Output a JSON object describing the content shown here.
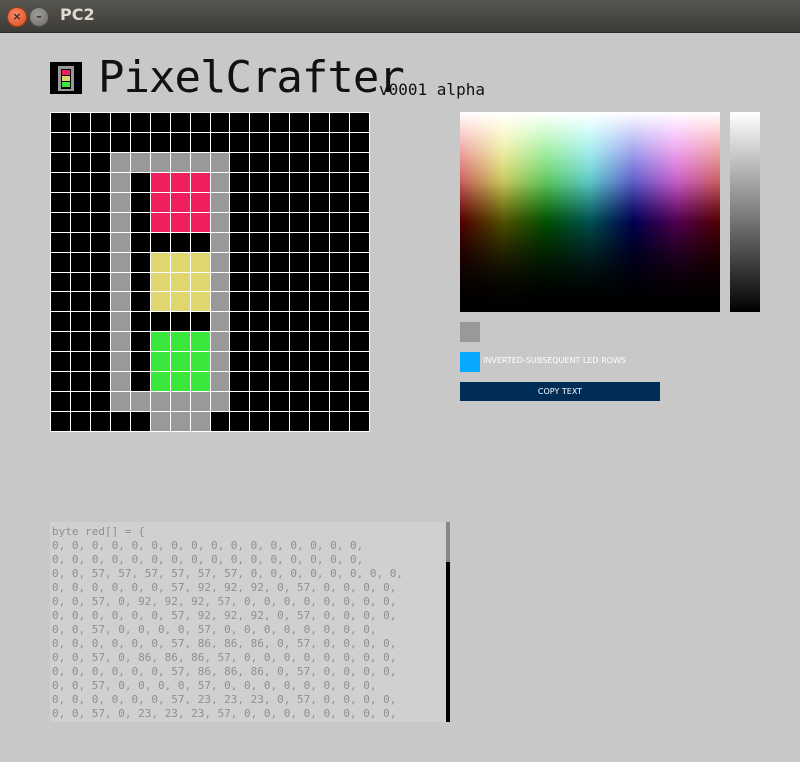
{
  "window": {
    "title": "PC2",
    "close_glyph": "×",
    "minimize_glyph": "–"
  },
  "app": {
    "title": "PixelCrafter",
    "version": "v0001 alpha"
  },
  "colors": {
    "accent": "#06a9ff",
    "button_bg": "#002d55",
    "grid_border": "#ffffff"
  },
  "grid": {
    "size": 16,
    "palette": {
      "0": "#000000",
      "1": "#999999",
      "2": "#ee1f5c",
      "3": "#dfd66f",
      "4": "#39e83b"
    },
    "pixels": [
      [
        0,
        0,
        0,
        0,
        0,
        0,
        0,
        0,
        0,
        0,
        0,
        0,
        0,
        0,
        0,
        0
      ],
      [
        0,
        0,
        0,
        0,
        0,
        0,
        0,
        0,
        0,
        0,
        0,
        0,
        0,
        0,
        0,
        0
      ],
      [
        0,
        0,
        0,
        1,
        1,
        1,
        1,
        1,
        1,
        0,
        0,
        0,
        0,
        0,
        0,
        0
      ],
      [
        0,
        0,
        0,
        1,
        0,
        2,
        2,
        2,
        1,
        0,
        0,
        0,
        0,
        0,
        0,
        0
      ],
      [
        0,
        0,
        0,
        1,
        0,
        2,
        2,
        2,
        1,
        0,
        0,
        0,
        0,
        0,
        0,
        0
      ],
      [
        0,
        0,
        0,
        1,
        0,
        2,
        2,
        2,
        1,
        0,
        0,
        0,
        0,
        0,
        0,
        0
      ],
      [
        0,
        0,
        0,
        1,
        0,
        0,
        0,
        0,
        1,
        0,
        0,
        0,
        0,
        0,
        0,
        0
      ],
      [
        0,
        0,
        0,
        1,
        0,
        3,
        3,
        3,
        1,
        0,
        0,
        0,
        0,
        0,
        0,
        0
      ],
      [
        0,
        0,
        0,
        1,
        0,
        3,
        3,
        3,
        1,
        0,
        0,
        0,
        0,
        0,
        0,
        0
      ],
      [
        0,
        0,
        0,
        1,
        0,
        3,
        3,
        3,
        1,
        0,
        0,
        0,
        0,
        0,
        0,
        0
      ],
      [
        0,
        0,
        0,
        1,
        0,
        0,
        0,
        0,
        1,
        0,
        0,
        0,
        0,
        0,
        0,
        0
      ],
      [
        0,
        0,
        0,
        1,
        0,
        4,
        4,
        4,
        1,
        0,
        0,
        0,
        0,
        0,
        0,
        0
      ],
      [
        0,
        0,
        0,
        1,
        0,
        4,
        4,
        4,
        1,
        0,
        0,
        0,
        0,
        0,
        0,
        0
      ],
      [
        0,
        0,
        0,
        1,
        0,
        4,
        4,
        4,
        1,
        0,
        0,
        0,
        0,
        0,
        0,
        0
      ],
      [
        0,
        0,
        0,
        1,
        1,
        1,
        1,
        1,
        1,
        0,
        0,
        0,
        0,
        0,
        0,
        0
      ],
      [
        0,
        0,
        0,
        0,
        0,
        1,
        1,
        1,
        0,
        0,
        0,
        0,
        0,
        0,
        0,
        0
      ]
    ]
  },
  "controls": {
    "current_color": "#999999",
    "toggle_label": "INVERTED-SUBSEQUENT LED ROWS",
    "copy_button": "COPY TEXT"
  },
  "code": {
    "lines": [
      "byte red[] = {",
      "0, 0, 0, 0, 0, 0, 0, 0, 0, 0, 0, 0, 0, 0, 0, 0,",
      "0, 0, 0, 0, 0, 0, 0, 0, 0, 0, 0, 0, 0, 0, 0, 0,",
      "0, 0, 57, 57, 57, 57, 57, 57, 0, 0, 0, 0, 0, 0, 0, 0,",
      "0, 0, 0, 0, 0, 0, 57, 92, 92, 92, 0, 57, 0, 0, 0, 0,",
      "0, 0, 57, 0, 92, 92, 92, 57, 0, 0, 0, 0, 0, 0, 0, 0,",
      "0, 0, 0, 0, 0, 0, 57, 92, 92, 92, 0, 57, 0, 0, 0, 0,",
      "0, 0, 57, 0, 0, 0, 0, 57, 0, 0, 0, 0, 0, 0, 0, 0,",
      "0, 0, 0, 0, 0, 0, 57, 86, 86, 86, 0, 57, 0, 0, 0, 0,",
      "0, 0, 57, 0, 86, 86, 86, 57, 0, 0, 0, 0, 0, 0, 0, 0,",
      "0, 0, 0, 0, 0, 0, 57, 86, 86, 86, 0, 57, 0, 0, 0, 0,",
      "0, 0, 57, 0, 0, 0, 0, 57, 0, 0, 0, 0, 0, 0, 0, 0,",
      "0, 0, 0, 0, 0, 0, 57, 23, 23, 23, 0, 57, 0, 0, 0, 0,",
      "0, 0, 57, 0, 23, 23, 23, 57, 0, 0, 0, 0, 0, 0, 0, 0,"
    ]
  }
}
